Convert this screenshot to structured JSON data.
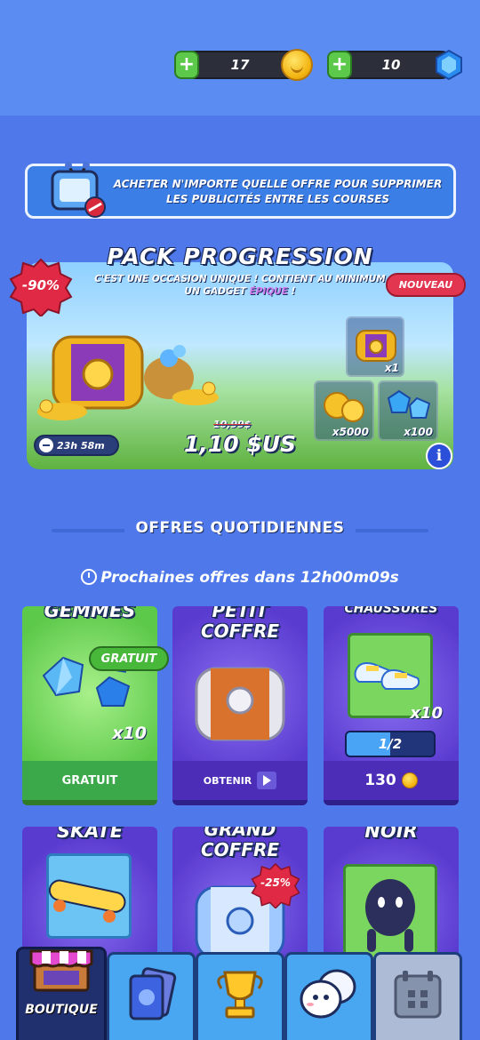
{
  "currencies": {
    "coins": "17",
    "gems": "10"
  },
  "promo": {
    "text": "ACHETER N'IMPORTE QUELLE OFFRE POUR SUPPRIMER LES PUBLICITÉS ENTRE LES COURSES"
  },
  "pack": {
    "title": "PACK PROGRESSION",
    "subtitle_pre": "C'EST UNE OCCASION UNIQUE ! CONTIENT AU MINIMUM UN GADGET ",
    "subtitle_epic": "ÉPIQUE",
    "subtitle_post": " !",
    "discount": "-90%",
    "new_badge": "NOUVEAU",
    "timer": "23h 58m",
    "old_price": "10,99$",
    "price": "1,10 $US",
    "items": [
      {
        "qty": "x1"
      },
      {
        "qty": "x5000"
      },
      {
        "qty": "x100"
      }
    ]
  },
  "daily": {
    "title": "OFFRES QUOTIDIENNES",
    "next_offers": "Prochaines offres dans 12h00m09s"
  },
  "cards": {
    "gems": {
      "title": "GEMMES",
      "tag": "GRATUIT",
      "qty": "x10",
      "foot": "GRATUIT"
    },
    "small_chest": {
      "title_1": "PETIT",
      "title_2": "COFFRE",
      "foot": "OBTENIR"
    },
    "shoes": {
      "title": "CHAUSSURES",
      "qty": "x10",
      "progress": "1/2",
      "progress_fraction": 0.5,
      "price": "130"
    },
    "skate": {
      "title": "SKATE"
    },
    "big_chest": {
      "title_1": "GRAND",
      "title_2": "COFFRE",
      "discount": "-25%"
    },
    "noir": {
      "title": "NOIR"
    }
  },
  "nav": {
    "shop": "BOUTIQUE"
  },
  "colors": {
    "background": "#4f79ea",
    "green_card": "#5cc94a",
    "purple_card": "#5a3bd0",
    "badge_red": "#e2354f"
  }
}
